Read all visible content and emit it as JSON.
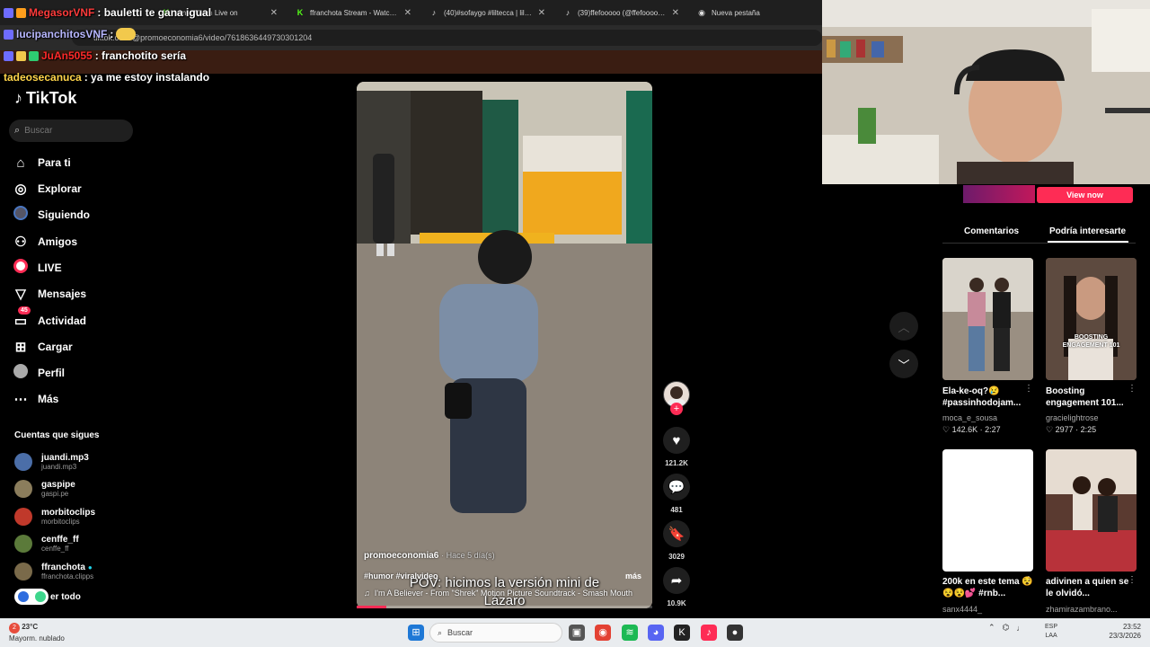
{
  "browser": {
    "tabs": [
      {
        "icon": "kick-icon",
        "label": "am - Watch Live on"
      },
      {
        "icon": "kick-icon",
        "label": "ffranchota Stream - Watch Live on"
      },
      {
        "icon": "tiktok-icon",
        "label": "(40)#sofaygo #liltecca | liltecca"
      },
      {
        "icon": "tiktok-icon",
        "label": "(39)ffefooooo (@ffefooooo) | Ti"
      },
      {
        "icon": "globe-icon",
        "label": "Nueva pestaña"
      }
    ],
    "url": "tiktok.com/@promoeconomia6/video/7618636449730301204"
  },
  "chat": [
    {
      "user": "MegasorVNF",
      "user_color": "#ff3b3b",
      "text": ": bauletti te gana igual"
    },
    {
      "user": "lucipanchitosVNF",
      "user_color": "#b7b7ff",
      "text": ":"
    },
    {
      "user": "JuAn5055",
      "user_color": "#ff2a2a",
      "text": ": franchotito sería"
    },
    {
      "user": "tadeosecanuca",
      "user_color": "#ffd54a",
      "text": ": ya me estoy instalando"
    }
  ],
  "tiktok": {
    "logo": "TikTok",
    "search_placeholder": "Buscar",
    "nav": [
      {
        "icon": "home-icon",
        "label": "Para ti"
      },
      {
        "icon": "compass-icon",
        "label": "Explorar"
      },
      {
        "icon": "following-avatar-icon",
        "label": "Siguiendo"
      },
      {
        "icon": "friends-icon",
        "label": "Amigos"
      },
      {
        "icon": "live-icon",
        "label": "LIVE"
      },
      {
        "icon": "messages-icon",
        "label": "Mensajes"
      },
      {
        "icon": "activity-icon",
        "label": "Actividad",
        "badge": "45"
      },
      {
        "icon": "upload-icon",
        "label": "Cargar"
      },
      {
        "icon": "profile-icon",
        "label": "Perfil"
      },
      {
        "icon": "more-icon",
        "label": "Más"
      }
    ],
    "following_title": "Cuentas que sigues",
    "following": [
      {
        "name": "juandi.mp3",
        "handle": "juandi.mp3",
        "verified": false,
        "color": "#4b6ea8"
      },
      {
        "name": "gaspipe",
        "handle": "gaspi.pe",
        "verified": false,
        "color": "#8b7d5c"
      },
      {
        "name": "morbitoclips",
        "handle": "morbitoclips",
        "verified": false,
        "color": "#c0392b"
      },
      {
        "name": "cenffe_ff",
        "handle": "cenffe_ff",
        "verified": false,
        "color": "#5b7a3a"
      },
      {
        "name": "ffranchota",
        "handle": "ffranchota.clipps",
        "verified": true,
        "color": "#7a6a4a"
      }
    ],
    "see_all": "er todo"
  },
  "video": {
    "caption": "POV: hicimos la versión mini de Lázaro",
    "author": "promoeconomia6",
    "ago": "· Hace 5 día(s)",
    "tags": "#humor #viralvideo",
    "more": "más",
    "music": "I'm A Believer - From \"Shrek\" Motion Picture Soundtrack - Smash Mouth",
    "progress": 0.1,
    "likes": "121.2K",
    "comments": "481",
    "saves": "3029",
    "shares": "10.9K"
  },
  "right_panel": {
    "view_now": "View now",
    "tabs": [
      "Comentarios",
      "Podría interesarte"
    ],
    "cards": [
      {
        "title": "Ela-ke-oq?😢 #passinhodojam...",
        "user": "moca_e_sousa",
        "likes": "142.6K",
        "duration": "2:27",
        "bg": "#8e8070"
      },
      {
        "title": "Boosting engagement 101...",
        "user": "gracielightrose",
        "likes": "2977",
        "duration": "2:25",
        "bg": "#6a5548",
        "overlay": "BOOSTING ENGAGEMENT 101"
      },
      {
        "title": "200k en este tema 😵😵😵💕 #rnb...",
        "user": "sanx4444_",
        "likes": "",
        "duration": "",
        "bg": "#ffffff"
      },
      {
        "title": "adivinen a quien se le olvidó...",
        "user": "zhamirazambrano...",
        "likes": "",
        "duration": "",
        "bg": "#7a4a3e"
      }
    ]
  },
  "taskbar": {
    "weather_temp": "23°C",
    "weather_text": "Mayorm. nublado",
    "weather_badge": "2",
    "search": "Buscar",
    "lang1": "ESP",
    "lang2": "LAA",
    "time": "23:52",
    "date": "23/3/2026"
  }
}
